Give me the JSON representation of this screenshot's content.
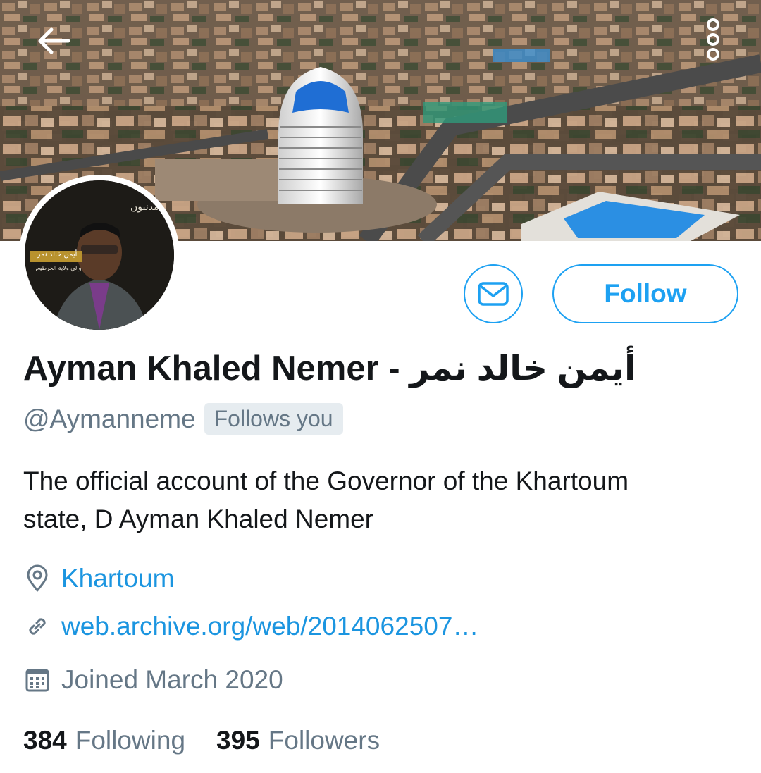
{
  "banner": {
    "back_icon": "arrow-left-icon",
    "more_icon": "more-vertical-icon"
  },
  "avatar": {
    "overlay_text_top": "مدنيون",
    "caption_line1": "أيمن خالد نمر",
    "caption_line2": "والي ولاية الخرطوم"
  },
  "actions": {
    "message_icon": "envelope-icon",
    "follow_label": "Follow",
    "accent_color": "#1da1f2"
  },
  "profile": {
    "display_name": "Ayman Khaled Nemer - أيمن خالد نمر",
    "handle": "@Aymanneme",
    "follows_you": "Follows you",
    "bio_line1": "The official account of the Governor of the Khartoum",
    "bio_line2": "state, D Ayman Khaled Nemer",
    "location": "Khartoum",
    "website": "web.archive.org/web/2014062507…",
    "joined": "Joined March 2020"
  },
  "stats": {
    "following_count": "384",
    "following_label": "Following",
    "followers_count": "395",
    "followers_label": "Followers"
  }
}
